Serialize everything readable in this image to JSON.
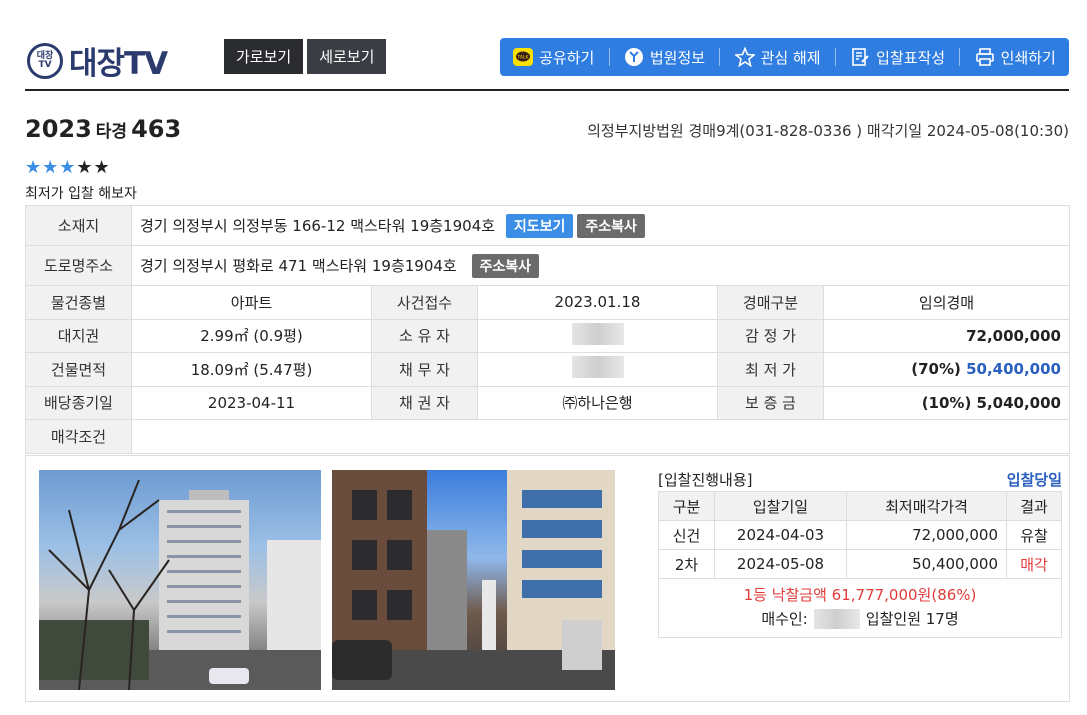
{
  "logo": {
    "badge": "대장TV",
    "text": "대장TV"
  },
  "view_buttons": {
    "horizontal": "가로보기",
    "vertical": "세로보기"
  },
  "toolbar": {
    "share": "공유하기",
    "court_info": "법원정보",
    "unfavorite": "관심 해제",
    "bid_form": "입찰표작성",
    "print": "인쇄하기",
    "colors": {
      "bar": "#2f7de1"
    }
  },
  "case": {
    "year": "2023",
    "type": "타경",
    "number": "463",
    "court_line": "의정부지방법원 경매9계(031-828-0336 ) 매각기일 2024-05-08(10:30)",
    "stars_on": "★★★",
    "stars_off": "★★",
    "memo": "최저가 입찰 해보자"
  },
  "info": {
    "location_label": "소재지",
    "location_value": "경기 의정부시 의정부동 166-12 맥스타워 19층1904호",
    "map_btn": "지도보기",
    "copy_btn": "주소복사",
    "road_label": "도로명주소",
    "road_value": "경기 의정부시 평화로 471 맥스타워 19층1904호",
    "road_copy_btn": "주소복사",
    "rows": {
      "kind_label": "물건종별",
      "kind_value": "아파트",
      "filed_label": "사건접수",
      "filed_value": "2023.01.18",
      "auction_type_label": "경매구분",
      "auction_type_value": "임의경매",
      "land_label": "대지권",
      "land_value": "2.99㎡ (0.9평)",
      "owner_label": "소 유 자",
      "appraisal_label": "감 정 가",
      "appraisal_value": "72,000,000",
      "building_label": "건물면적",
      "building_value": "18.09㎡ (5.47평)",
      "debtor_label": "채 무 자",
      "min_label": "최 저 가",
      "min_pct": "(70%)",
      "min_value": "50,400,000",
      "deadline_label": "배당종기일",
      "deadline_value": "2023-04-11",
      "creditor_label": "채 권 자",
      "creditor_value": "㈜하나은행",
      "deposit_label": "보 증 금",
      "deposit_value": "(10%) 5,040,000",
      "condition_label": "매각조건",
      "condition_value": ""
    }
  },
  "bidding": {
    "title": "[입찰진행내용]",
    "today_link": "입찰당일",
    "headers": [
      "구분",
      "입찰기일",
      "최저매각가격",
      "결과"
    ],
    "rows": [
      {
        "round": "신건",
        "date": "2024-04-03",
        "price": "72,000,000",
        "result": "유찰"
      },
      {
        "round": "2차",
        "date": "2024-05-08",
        "price": "50,400,000",
        "result": "매각"
      }
    ],
    "winning": "1등 낙찰금액 61,777,000원(86%)",
    "buyer_label": "매수인:",
    "bidders": "입찰인원 17명"
  }
}
